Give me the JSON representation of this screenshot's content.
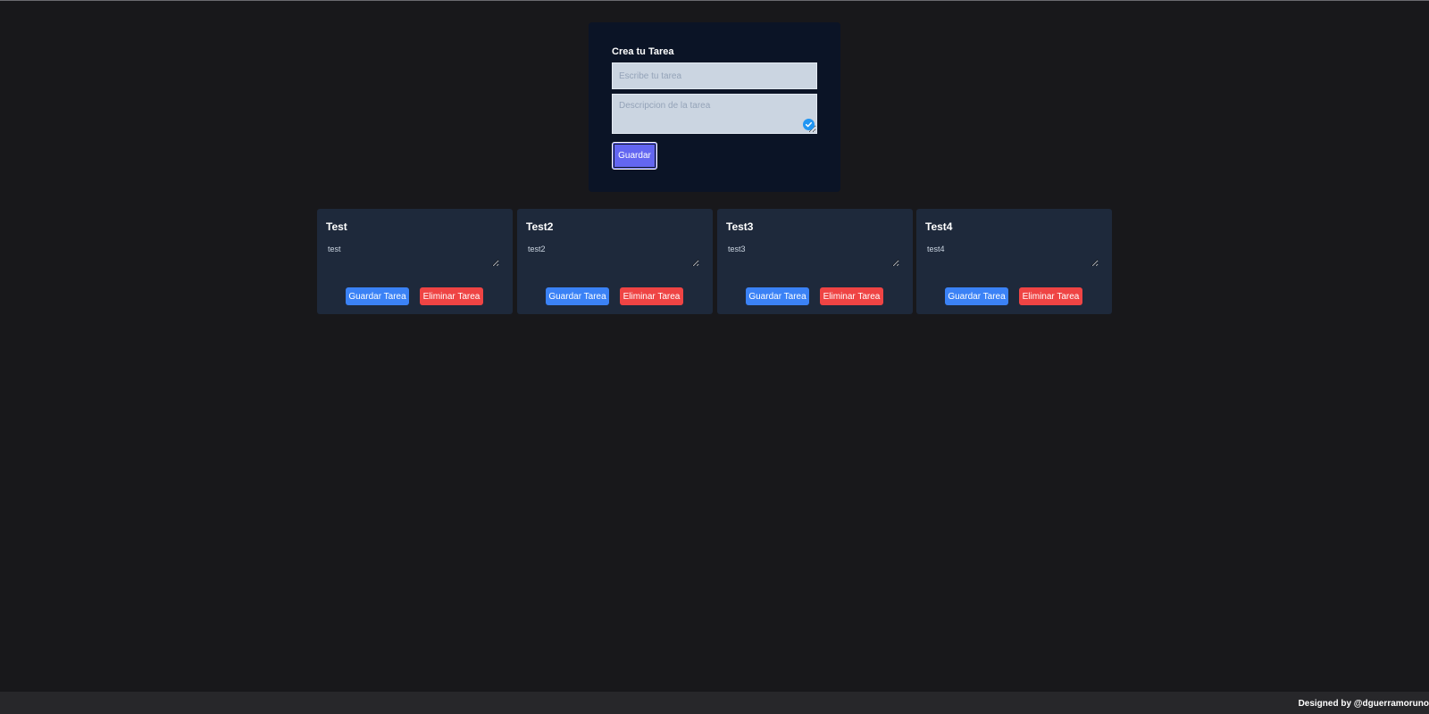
{
  "form": {
    "title": "Crea tu Tarea",
    "task_placeholder": "Escribe tu tarea",
    "task_value": "",
    "description_placeholder": "Descripcion de la tarea",
    "description_value": "",
    "save_label": "Guardar"
  },
  "tasks": [
    {
      "title": "Test",
      "description": "test",
      "save_label": "Guardar Tarea",
      "delete_label": "Eliminar Tarea"
    },
    {
      "title": "Test2",
      "description": "test2",
      "save_label": "Guardar Tarea",
      "delete_label": "Eliminar Tarea"
    },
    {
      "title": "Test3",
      "description": "test3",
      "save_label": "Guardar Tarea",
      "delete_label": "Eliminar Tarea"
    },
    {
      "title": "Test4",
      "description": "test4",
      "save_label": "Guardar Tarea",
      "delete_label": "Eliminar Tarea"
    }
  ],
  "footer": {
    "text": "Designed by @dguerramoruno"
  },
  "colors": {
    "background": "#18181b",
    "form_card": "#0b1426",
    "task_card": "#1e293b",
    "save_button": "#6366f1",
    "card_save_button": "#3b82f6",
    "card_delete_button": "#ef4444",
    "footer": "#27272a"
  },
  "icons": {
    "description_badge": "check-circle-icon"
  }
}
